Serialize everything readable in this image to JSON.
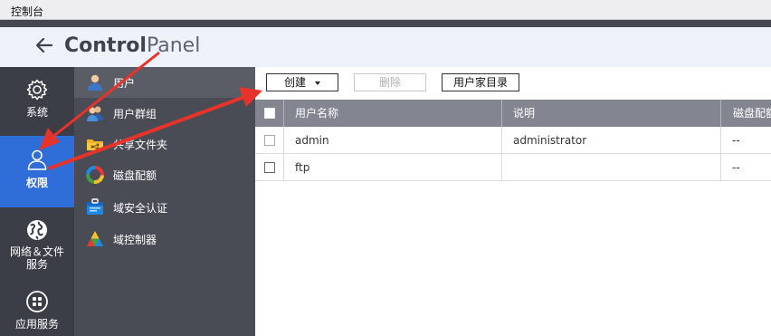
{
  "window": {
    "title": "控制台"
  },
  "header": {
    "brand_part1": "Control",
    "brand_part2": "Panel"
  },
  "left_nav": {
    "items": [
      {
        "label": "系统",
        "icon": "gear-icon"
      },
      {
        "label": "权限",
        "icon": "user-icon",
        "active": true
      },
      {
        "label": "网络＆文件服务",
        "icon": "globe-icon"
      },
      {
        "label": "应用服务",
        "icon": "apps-icon"
      }
    ]
  },
  "sub_nav": {
    "items": [
      {
        "label": "用户",
        "icon": "user-icon",
        "active": true
      },
      {
        "label": "用户群组",
        "icon": "user-group-icon"
      },
      {
        "label": "共享文件夹",
        "icon": "shared-folder-icon"
      },
      {
        "label": "磁盘配额",
        "icon": "disk-quota-icon"
      },
      {
        "label": "域安全认证",
        "icon": "domain-security-icon"
      },
      {
        "label": "域控制器",
        "icon": "domain-controller-icon"
      }
    ]
  },
  "toolbar": {
    "create_label": "创建",
    "delete_label": "删除",
    "home_folder_label": "用户家目录"
  },
  "table": {
    "columns": [
      "用户名称",
      "说明",
      "磁盘配额"
    ],
    "rows": [
      {
        "username": "admin",
        "description": "administrator",
        "quota": "--"
      },
      {
        "username": "ftp",
        "description": "",
        "quota": "--"
      }
    ]
  },
  "colors": {
    "accent": "#2f6ed8",
    "annotation_arrow": "#e8332a",
    "nav_bg": "#3c3e47",
    "subnav_bg": "#4a4c55",
    "table_header": "#838591"
  }
}
